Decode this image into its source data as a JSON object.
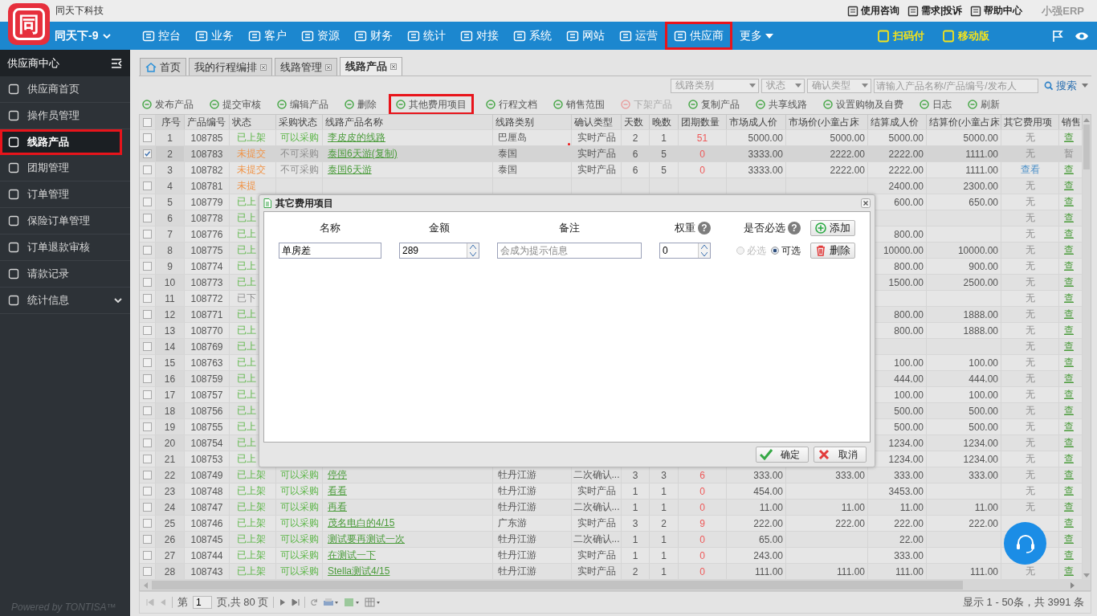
{
  "brand": {
    "logo_text": "同",
    "company": "同天下科技",
    "account": "同天下-9"
  },
  "top_links": [
    {
      "label": "使用咨询"
    },
    {
      "label": "需求|投诉"
    },
    {
      "label": "帮助中心"
    }
  ],
  "erp_logo": "小强ERP",
  "nav": [
    {
      "label": "控台",
      "highlighted": false
    },
    {
      "label": "业务",
      "highlighted": false
    },
    {
      "label": "客户",
      "highlighted": false
    },
    {
      "label": "资源",
      "highlighted": false
    },
    {
      "label": "财务",
      "highlighted": false
    },
    {
      "label": "统计",
      "highlighted": false
    },
    {
      "label": "对接",
      "highlighted": false
    },
    {
      "label": "系统",
      "highlighted": false
    },
    {
      "label": "网站",
      "highlighted": false
    },
    {
      "label": "运营",
      "highlighted": false
    },
    {
      "label": "供应商",
      "highlighted": true
    }
  ],
  "more": "更多",
  "nav_right": [
    "扫码付",
    "移动版"
  ],
  "sidebar": {
    "title": "供应商中心",
    "items": [
      {
        "label": "供应商首页",
        "selected": false,
        "highlighted": false
      },
      {
        "label": "操作员管理",
        "selected": false,
        "highlighted": false
      },
      {
        "label": "线路产品",
        "selected": true,
        "highlighted": true
      },
      {
        "label": "团期管理",
        "selected": false,
        "highlighted": false
      },
      {
        "label": "订单管理",
        "selected": false,
        "highlighted": false
      },
      {
        "label": "保险订单管理",
        "selected": false,
        "highlighted": false
      },
      {
        "label": "订单退款审核",
        "selected": false,
        "highlighted": false
      },
      {
        "label": "请款记录",
        "selected": false,
        "highlighted": false
      },
      {
        "label": "统计信息",
        "selected": false,
        "highlighted": false,
        "expandable": true
      }
    ],
    "footer": "Powered by TONTISA™"
  },
  "tabs": [
    {
      "label": "首页",
      "selected": false,
      "closable": false
    },
    {
      "label": "我的行程编排",
      "selected": false,
      "closable": true
    },
    {
      "label": "线路管理",
      "selected": false,
      "closable": true
    },
    {
      "label": "线路产品",
      "selected": true,
      "closable": true
    }
  ],
  "filters": {
    "selects": [
      "线路类别",
      "状态",
      "确认类型"
    ],
    "search_placeholder": "请输入产品名称/产品编号/发布人",
    "search_button": "搜索"
  },
  "toolbar": [
    {
      "label": "发布产品",
      "disabled": false,
      "highlighted": false
    },
    {
      "label": "提交审核",
      "disabled": false,
      "highlighted": false
    },
    {
      "label": "编辑产品",
      "disabled": false,
      "highlighted": false
    },
    {
      "label": "删除",
      "disabled": false,
      "highlighted": false
    },
    {
      "label": "其他费用项目",
      "disabled": false,
      "highlighted": true
    },
    {
      "label": "行程文档",
      "disabled": false,
      "highlighted": false
    },
    {
      "label": "销售范围",
      "disabled": false,
      "highlighted": false
    },
    {
      "label": "下架产品",
      "disabled": true,
      "highlighted": false
    },
    {
      "label": "复制产品",
      "disabled": false,
      "highlighted": false
    },
    {
      "label": "共享线路",
      "disabled": false,
      "highlighted": false
    },
    {
      "label": "设置购物及自费",
      "disabled": false,
      "highlighted": false
    },
    {
      "label": "日志",
      "disabled": false,
      "highlighted": false
    },
    {
      "label": "刷新",
      "disabled": false,
      "highlighted": false
    }
  ],
  "table": {
    "all_selected": false,
    "columns": [
      "序号",
      "产品编号",
      "状态",
      "采购状态",
      "线路产品名称",
      "线路类别",
      "确认类型",
      "天数",
      "晚数",
      "团期数量",
      "市场成人价",
      "市场价(小童占床",
      "结算成人价",
      "结算价(小童占床",
      "其它费用项",
      "销售"
    ],
    "rows": [
      {
        "selected": false,
        "no": "1",
        "code": "108785",
        "status": {
          "text": "已上架",
          "kind": "listed"
        },
        "purchase": "可以采购",
        "purchasable": true,
        "name": "李皮皮的线路",
        "category": "巴厘岛",
        "confirm": "实时产品",
        "days": "2",
        "nights": "1",
        "groups": "51",
        "market_adult": "5000.00",
        "market_child": "5000.00",
        "settle_adult": "5000.00",
        "settle_child": "5000.00",
        "extras": "无",
        "extras_link": false,
        "sale": "查",
        "sale_link": true
      },
      {
        "selected": true,
        "no": "2",
        "code": "108783",
        "status": {
          "text": "未提交",
          "kind": "draft"
        },
        "purchase": "不可采购",
        "purchasable": false,
        "name": "泰国6天游(复制)",
        "category": "泰国",
        "confirm": "实时产品",
        "days": "6",
        "nights": "5",
        "groups": "0",
        "market_adult": "3333.00",
        "market_child": "2222.00",
        "settle_adult": "2222.00",
        "settle_child": "1111.00",
        "extras": "无",
        "extras_link": false,
        "sale": "暂",
        "sale_link": false
      },
      {
        "selected": false,
        "no": "3",
        "code": "108782",
        "status": {
          "text": "未提交",
          "kind": "draft"
        },
        "purchase": "不可采购",
        "purchasable": false,
        "name": "泰国6天游",
        "category": "泰国",
        "confirm": "实时产品",
        "days": "6",
        "nights": "5",
        "groups": "0",
        "market_adult": "3333.00",
        "market_child": "2222.00",
        "settle_adult": "2222.00",
        "settle_child": "1111.00",
        "extras": "查看",
        "extras_link": true,
        "sale": "查",
        "sale_link": true
      },
      {
        "selected": false,
        "no": "4",
        "code": "108781",
        "status": {
          "text": "未提",
          "kind": "draft"
        },
        "settle_adult": "2400.00",
        "settle_child": "2300.00",
        "extras": "无",
        "extras_link": false,
        "sale": "查",
        "sale_link": true
      },
      {
        "selected": false,
        "no": "5",
        "code": "108779",
        "status": {
          "text": "已上",
          "kind": "listed"
        },
        "settle_adult": "600.00",
        "settle_child": "650.00",
        "extras": "无",
        "extras_link": false,
        "sale": "查",
        "sale_link": true
      },
      {
        "selected": false,
        "no": "6",
        "code": "108778",
        "status": {
          "text": "已上",
          "kind": "listed"
        },
        "extras": "无",
        "extras_link": false,
        "sale": "查",
        "sale_link": true
      },
      {
        "selected": false,
        "no": "7",
        "code": "108776",
        "status": {
          "text": "已上",
          "kind": "listed"
        },
        "settle_adult": "800.00",
        "extras": "无",
        "extras_link": false,
        "sale": "查",
        "sale_link": true
      },
      {
        "selected": false,
        "no": "8",
        "code": "108775",
        "status": {
          "text": "已上",
          "kind": "listed"
        },
        "settle_adult": "10000.00",
        "settle_child": "10000.00",
        "extras": "无",
        "extras_link": false,
        "sale": "查",
        "sale_link": true
      },
      {
        "selected": false,
        "no": "9",
        "code": "108774",
        "status": {
          "text": "已上",
          "kind": "listed"
        },
        "settle_adult": "800.00",
        "settle_child": "900.00",
        "extras": "无",
        "extras_link": false,
        "sale": "查",
        "sale_link": true
      },
      {
        "selected": false,
        "no": "10",
        "code": "108773",
        "status": {
          "text": "已上",
          "kind": "listed"
        },
        "settle_adult": "1500.00",
        "settle_child": "2500.00",
        "extras": "无",
        "extras_link": false,
        "sale": "查",
        "sale_link": true
      },
      {
        "selected": false,
        "no": "11",
        "code": "108772",
        "status": {
          "text": "已下",
          "kind": "offline"
        },
        "extras": "无",
        "extras_link": false,
        "sale": "查",
        "sale_link": true
      },
      {
        "selected": false,
        "no": "12",
        "code": "108771",
        "status": {
          "text": "已上",
          "kind": "listed"
        },
        "settle_adult": "800.00",
        "settle_child": "1888.00",
        "extras": "无",
        "extras_link": false,
        "sale": "查",
        "sale_link": true
      },
      {
        "selected": false,
        "no": "13",
        "code": "108770",
        "status": {
          "text": "已上",
          "kind": "listed"
        },
        "settle_adult": "800.00",
        "settle_child": "1888.00",
        "extras": "无",
        "extras_link": false,
        "sale": "查",
        "sale_link": true
      },
      {
        "selected": false,
        "no": "14",
        "code": "108769",
        "status": {
          "text": "已上",
          "kind": "listed"
        },
        "extras": "无",
        "extras_link": false,
        "sale": "查",
        "sale_link": true
      },
      {
        "selected": false,
        "no": "15",
        "code": "108763",
        "status": {
          "text": "已上",
          "kind": "listed"
        },
        "settle_adult": "100.00",
        "settle_child": "100.00",
        "extras": "无",
        "extras_link": false,
        "sale": "查",
        "sale_link": true
      },
      {
        "selected": false,
        "no": "16",
        "code": "108759",
        "status": {
          "text": "已上",
          "kind": "listed"
        },
        "settle_adult": "444.00",
        "settle_child": "444.00",
        "extras": "无",
        "extras_link": false,
        "sale": "查",
        "sale_link": true
      },
      {
        "selected": false,
        "no": "17",
        "code": "108757",
        "status": {
          "text": "已上",
          "kind": "listed"
        },
        "settle_adult": "100.00",
        "settle_child": "100.00",
        "extras": "无",
        "extras_link": false,
        "sale": "查",
        "sale_link": true
      },
      {
        "selected": false,
        "no": "18",
        "code": "108756",
        "status": {
          "text": "已上",
          "kind": "listed"
        },
        "settle_adult": "500.00",
        "settle_child": "500.00",
        "extras": "无",
        "extras_link": false,
        "sale": "查",
        "sale_link": true
      },
      {
        "selected": false,
        "no": "19",
        "code": "108755",
        "status": {
          "text": "已上",
          "kind": "listed"
        },
        "settle_adult": "500.00",
        "settle_child": "500.00",
        "extras": "无",
        "extras_link": false,
        "sale": "查",
        "sale_link": true
      },
      {
        "selected": false,
        "no": "20",
        "code": "108754",
        "status": {
          "text": "已上",
          "kind": "listed"
        },
        "settle_adult": "1234.00",
        "settle_child": "1234.00",
        "extras": "无",
        "extras_link": false,
        "sale": "查",
        "sale_link": true
      },
      {
        "selected": false,
        "no": "21",
        "code": "108753",
        "status": {
          "text": "已上",
          "kind": "listed"
        },
        "settle_adult": "1234.00",
        "settle_child": "1234.00",
        "extras": "无",
        "extras_link": false,
        "sale": "查",
        "sale_link": true
      },
      {
        "selected": false,
        "no": "22",
        "code": "108749",
        "status": {
          "text": "已上架",
          "kind": "listed"
        },
        "purchase": "可以采购",
        "purchasable": true,
        "name": "停停",
        "category": "牡丹江游",
        "confirm": "二次确认...",
        "days": "3",
        "nights": "3",
        "groups": "6",
        "market_adult": "333.00",
        "market_child": "333.00",
        "settle_adult": "333.00",
        "settle_child": "333.00",
        "extras": "无",
        "extras_link": false,
        "sale": "查",
        "sale_link": true
      },
      {
        "selected": false,
        "no": "23",
        "code": "108748",
        "status": {
          "text": "已上架",
          "kind": "listed"
        },
        "purchase": "可以采购",
        "purchasable": true,
        "name": "看看",
        "category": "牡丹江游",
        "confirm": "实时产品",
        "days": "1",
        "nights": "1",
        "groups": "0",
        "market_adult": "454.00",
        "settle_adult": "3453.00",
        "extras": "无",
        "extras_link": false,
        "sale": "查",
        "sale_link": true
      },
      {
        "selected": false,
        "no": "24",
        "code": "108747",
        "status": {
          "text": "已上架",
          "kind": "listed"
        },
        "purchase": "可以采购",
        "purchasable": true,
        "name": "再看",
        "category": "牡丹江游",
        "confirm": "二次确认...",
        "days": "1",
        "nights": "1",
        "groups": "0",
        "market_adult": "11.00",
        "market_child": "11.00",
        "settle_adult": "11.00",
        "settle_child": "11.00",
        "extras": "无",
        "extras_link": false,
        "sale": "查",
        "sale_link": true
      },
      {
        "selected": false,
        "no": "25",
        "code": "108746",
        "status": {
          "text": "已上架",
          "kind": "listed"
        },
        "purchase": "可以采购",
        "purchasable": true,
        "name": "茂名电白的4/15",
        "category": "广东游",
        "confirm": "实时产品",
        "days": "3",
        "nights": "2",
        "groups": "9",
        "market_adult": "222.00",
        "market_child": "222.00",
        "settle_adult": "222.00",
        "settle_child": "222.00",
        "sale": "查",
        "sale_link": true
      },
      {
        "selected": false,
        "no": "26",
        "code": "108745",
        "status": {
          "text": "已上架",
          "kind": "listed"
        },
        "purchase": "可以采购",
        "purchasable": true,
        "name": "测试要再测试一次",
        "category": "牡丹江游",
        "confirm": "二次确认...",
        "days": "1",
        "nights": "1",
        "groups": "0",
        "market_adult": "65.00",
        "settle_adult": "22.00",
        "sale": "查",
        "sale_link": true
      },
      {
        "selected": false,
        "no": "27",
        "code": "108744",
        "status": {
          "text": "已上架",
          "kind": "listed"
        },
        "purchase": "可以采购",
        "purchasable": true,
        "name": "在测试一下",
        "category": "牡丹江游",
        "confirm": "实时产品",
        "days": "1",
        "nights": "1",
        "groups": "0",
        "market_adult": "243.00",
        "settle_adult": "333.00",
        "sale": "查",
        "sale_link": true
      },
      {
        "selected": false,
        "no": "28",
        "code": "108743",
        "status": {
          "text": "已上架",
          "kind": "listed"
        },
        "purchase": "可以采购",
        "purchasable": true,
        "name": "Stella测试4/15",
        "category": "牡丹江游",
        "confirm": "实时产品",
        "days": "2",
        "nights": "1",
        "groups": "0",
        "market_adult": "111.00",
        "market_child": "111.00",
        "settle_adult": "111.00",
        "settle_child": "111.00",
        "extras": "无",
        "extras_link": false,
        "sale": "查",
        "sale_link": true
      }
    ]
  },
  "pager": {
    "page_label": "第",
    "page": "1",
    "total_label": "页,共 80 页",
    "summary": "显示 1 - 50条，共 3991 条"
  },
  "dialog": {
    "title": "其它费用项目",
    "headers": [
      {
        "label": "名称"
      },
      {
        "label": "金额"
      },
      {
        "label": "备注"
      },
      {
        "label": "权重",
        "help": "?"
      },
      {
        "label": "是否必选",
        "help": "?"
      }
    ],
    "add_button": "添加",
    "items": [
      {
        "name": "单房差",
        "amount": "289",
        "note_placeholder": "会成为提示信息",
        "weight": "0",
        "options": [
          {
            "label": "必选",
            "selected": false,
            "disabled": true
          },
          {
            "label": "可选",
            "selected": true,
            "disabled": false
          }
        ],
        "delete_button": "删除"
      }
    ],
    "buttons": [
      {
        "label": "确定",
        "kind": "ok"
      },
      {
        "label": "取消",
        "kind": "cancel"
      }
    ]
  }
}
